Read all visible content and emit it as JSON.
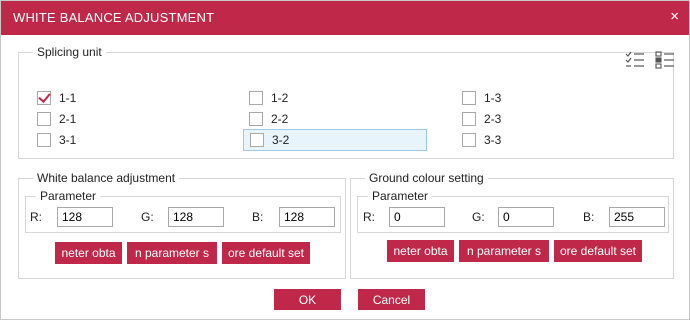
{
  "window": {
    "title": "WHITE BALANCE ADJUSTMENT",
    "close_glyph": "×"
  },
  "splicing": {
    "legend": "Splicing unit",
    "view_icons": [
      "checklist-icon",
      "list-view-icon"
    ],
    "units": [
      {
        "label": "1-1",
        "checked": true
      },
      {
        "label": "1-2",
        "checked": false
      },
      {
        "label": "1-3",
        "checked": false
      },
      {
        "label": "2-1",
        "checked": false
      },
      {
        "label": "2-2",
        "checked": false
      },
      {
        "label": "2-3",
        "checked": false
      },
      {
        "label": "3-1",
        "checked": false
      },
      {
        "label": "3-2",
        "checked": false,
        "selected": true
      },
      {
        "label": "3-3",
        "checked": false
      }
    ]
  },
  "white_balance": {
    "legend": "White balance adjustment",
    "parameter_legend": "Parameter",
    "r_label": "R:",
    "r_value": "128",
    "g_label": "G:",
    "g_value": "128",
    "b_label": "B:",
    "b_value": "128",
    "buttons": [
      "neter obta",
      "n parameter s",
      "ore default set"
    ]
  },
  "ground_colour": {
    "legend": "Ground colour setting",
    "parameter_legend": "Parameter",
    "r_label": "R:",
    "r_value": "0",
    "g_label": "G:",
    "g_value": "0",
    "b_label": "B:",
    "b_value": "255",
    "buttons": [
      "neter obta",
      "n parameter s",
      "ore default set"
    ]
  },
  "footer": {
    "ok_label": "OK",
    "cancel_label": "Cancel"
  },
  "colors": {
    "accent": "#c0284a",
    "selected_bg": "#e8f4fb"
  }
}
